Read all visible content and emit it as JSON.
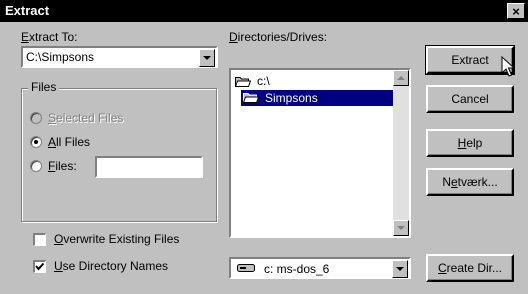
{
  "window": {
    "title": "Extract",
    "close_glyph": "×"
  },
  "extract_to": {
    "label_accel": "E",
    "label_rest": "xtract To:",
    "value": "C:\\Simpsons"
  },
  "files_group": {
    "title": "Files",
    "selected": {
      "accel": "S",
      "rest": "elected Files",
      "checked": false,
      "disabled": true
    },
    "all": {
      "accel": "A",
      "rest": "ll Files",
      "checked": true
    },
    "files": {
      "accel": "F",
      "rest": "iles:",
      "checked": false,
      "value": ""
    }
  },
  "overwrite": {
    "accel": "O",
    "rest": "verwrite Existing Files",
    "checked": false
  },
  "use_dirs": {
    "accel": "U",
    "rest": "se Directory Names",
    "checked": true
  },
  "directories": {
    "label_accel": "D",
    "label_rest": "irectories/Drives:",
    "items": [
      {
        "name": "c:\\",
        "selected": false,
        "icon": "open-folder-icon"
      },
      {
        "name": "Simpsons",
        "selected": true,
        "icon": "open-folder-icon"
      }
    ]
  },
  "drive": {
    "value": "c: ms-dos_6",
    "icon": "drive-icon"
  },
  "buttons": {
    "extract": "Extract",
    "cancel": "Cancel",
    "help_accel": "H",
    "help_rest": "elp",
    "netvaerk_pre": "N",
    "netvaerk_accel": "e",
    "netvaerk_rest": "tværk...",
    "create_accel": "C",
    "create_rest": "reate Dir..."
  },
  "colors": {
    "face": "#c0c0c0",
    "selection": "#000080",
    "titlebar": "#000000"
  }
}
